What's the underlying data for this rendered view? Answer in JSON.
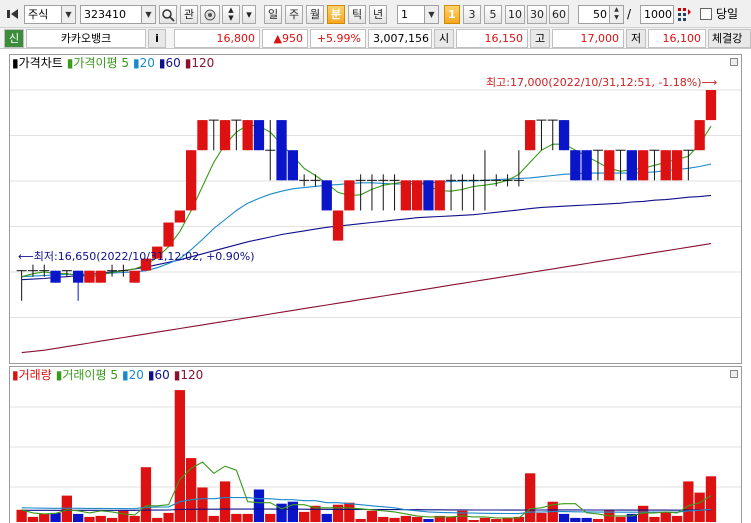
{
  "toolbar": {
    "market_select": "주식",
    "code": "323410",
    "search_icon": "search-icon",
    "btn_interest": "관",
    "period_buttons": [
      "일",
      "주",
      "월",
      "분",
      "틱",
      "년"
    ],
    "active_period": "분",
    "interval_value": "1",
    "minute_buttons": [
      "1",
      "3",
      "5",
      "10",
      "30",
      "60"
    ],
    "active_minute": "1",
    "count_value": "50",
    "slash": "/",
    "total_value": "1000",
    "same_day_label": "당일"
  },
  "quote": {
    "badge": "신",
    "name": "카카오뱅크",
    "info": "i",
    "price": "16,800",
    "change": "▲950",
    "change_pct": "+5.99%",
    "volume": "3,007,156",
    "open_label": "시",
    "open": "16,150",
    "high_label": "고",
    "high": "17,000",
    "low_label": "저",
    "low": "16,100",
    "strength_label": "체결강"
  },
  "colors": {
    "up": "#dd1111",
    "down": "#0a14c8",
    "ma5": "#3a9a1a",
    "ma20": "#1a8acb",
    "ma60": "#10108a",
    "ma120": "#8a1030"
  },
  "price_panel": {
    "title": "가격차트",
    "legend": [
      {
        "label": "가격이평 5",
        "color": "#3a9a1a"
      },
      {
        "label": "20",
        "color": "#1a8acb"
      },
      {
        "label": "60",
        "color": "#10108a"
      },
      {
        "label": "120",
        "color": "#8a1030"
      }
    ],
    "high_annotation": "최고:17,000(2022/10/31,12:51, -1.18%)⟶",
    "low_annotation": "⟵최저:16,650(2022/10/31,12:02, +0.90%)"
  },
  "volume_panel": {
    "title": "거래량",
    "legend": [
      {
        "label": "거래이평 5",
        "color": "#3a9a1a"
      },
      {
        "label": "20",
        "color": "#1a8acb"
      },
      {
        "label": "60",
        "color": "#10108a"
      },
      {
        "label": "120",
        "color": "#8a1030"
      }
    ]
  },
  "chart_data": {
    "type": "candlestick",
    "ylim": [
      16650,
      17000
    ],
    "candles": [
      {
        "o": 16700,
        "c": 16700,
        "h": 16700,
        "l": 16650,
        "d": "flat"
      },
      {
        "o": 16700,
        "c": 16700,
        "h": 16710,
        "l": 16690,
        "d": "flat"
      },
      {
        "o": 16700,
        "c": 16700,
        "h": 16710,
        "l": 16690,
        "d": "flat"
      },
      {
        "o": 16700,
        "c": 16680,
        "h": 16700,
        "l": 16680,
        "d": "down"
      },
      {
        "o": 16700,
        "c": 16700,
        "h": 16700,
        "l": 16690,
        "d": "flat"
      },
      {
        "o": 16700,
        "c": 16680,
        "h": 16700,
        "l": 16650,
        "d": "down"
      },
      {
        "o": 16680,
        "c": 16700,
        "h": 16700,
        "l": 16680,
        "d": "up"
      },
      {
        "o": 16680,
        "c": 16700,
        "h": 16700,
        "l": 16680,
        "d": "up"
      },
      {
        "o": 16700,
        "c": 16700,
        "h": 16710,
        "l": 16690,
        "d": "flat"
      },
      {
        "o": 16700,
        "c": 16700,
        "h": 16710,
        "l": 16690,
        "d": "flat"
      },
      {
        "o": 16680,
        "c": 16700,
        "h": 16700,
        "l": 16680,
        "d": "up"
      },
      {
        "o": 16700,
        "c": 16720,
        "h": 16720,
        "l": 16700,
        "d": "up"
      },
      {
        "o": 16720,
        "c": 16740,
        "h": 16740,
        "l": 16720,
        "d": "up"
      },
      {
        "o": 16740,
        "c": 16780,
        "h": 16780,
        "l": 16740,
        "d": "up"
      },
      {
        "o": 16780,
        "c": 16800,
        "h": 16800,
        "l": 16780,
        "d": "up"
      },
      {
        "o": 16800,
        "c": 16900,
        "h": 16900,
        "l": 16800,
        "d": "up"
      },
      {
        "o": 16900,
        "c": 16950,
        "h": 16950,
        "l": 16900,
        "d": "up"
      },
      {
        "o": 16950,
        "c": 16950,
        "h": 16950,
        "l": 16900,
        "d": "flat"
      },
      {
        "o": 16900,
        "c": 16950,
        "h": 16950,
        "l": 16900,
        "d": "up"
      },
      {
        "o": 16950,
        "c": 16950,
        "h": 16950,
        "l": 16900,
        "d": "flat"
      },
      {
        "o": 16900,
        "c": 16950,
        "h": 16950,
        "l": 16900,
        "d": "up"
      },
      {
        "o": 16950,
        "c": 16900,
        "h": 16950,
        "l": 16900,
        "d": "down"
      },
      {
        "o": 16900,
        "c": 16900,
        "h": 16950,
        "l": 16850,
        "d": "flat"
      },
      {
        "o": 16950,
        "c": 16850,
        "h": 16950,
        "l": 16850,
        "d": "down"
      },
      {
        "o": 16900,
        "c": 16850,
        "h": 16900,
        "l": 16850,
        "d": "down"
      },
      {
        "o": 16850,
        "c": 16850,
        "h": 16860,
        "l": 16840,
        "d": "flat"
      },
      {
        "o": 16850,
        "c": 16850,
        "h": 16860,
        "l": 16840,
        "d": "flat"
      },
      {
        "o": 16850,
        "c": 16800,
        "h": 16850,
        "l": 16800,
        "d": "down"
      },
      {
        "o": 16750,
        "c": 16800,
        "h": 16800,
        "l": 16750,
        "d": "up"
      },
      {
        "o": 16800,
        "c": 16850,
        "h": 16850,
        "l": 16800,
        "d": "up"
      },
      {
        "o": 16850,
        "c": 16850,
        "h": 16860,
        "l": 16800,
        "d": "flat"
      },
      {
        "o": 16850,
        "c": 16850,
        "h": 16860,
        "l": 16800,
        "d": "flat"
      },
      {
        "o": 16850,
        "c": 16850,
        "h": 16860,
        "l": 16800,
        "d": "flat"
      },
      {
        "o": 16850,
        "c": 16850,
        "h": 16860,
        "l": 16800,
        "d": "flat"
      },
      {
        "o": 16800,
        "c": 16850,
        "h": 16850,
        "l": 16800,
        "d": "up"
      },
      {
        "o": 16800,
        "c": 16850,
        "h": 16850,
        "l": 16800,
        "d": "up"
      },
      {
        "o": 16850,
        "c": 16800,
        "h": 16850,
        "l": 16800,
        "d": "down"
      },
      {
        "o": 16800,
        "c": 16850,
        "h": 16850,
        "l": 16800,
        "d": "up"
      },
      {
        "o": 16850,
        "c": 16850,
        "h": 16860,
        "l": 16800,
        "d": "flat"
      },
      {
        "o": 16850,
        "c": 16850,
        "h": 16860,
        "l": 16800,
        "d": "flat"
      },
      {
        "o": 16850,
        "c": 16850,
        "h": 16860,
        "l": 16800,
        "d": "flat"
      },
      {
        "o": 16850,
        "c": 16850,
        "h": 16900,
        "l": 16800,
        "d": "flat"
      },
      {
        "o": 16850,
        "c": 16850,
        "h": 16860,
        "l": 16840,
        "d": "flat"
      },
      {
        "o": 16850,
        "c": 16850,
        "h": 16860,
        "l": 16840,
        "d": "flat"
      },
      {
        "o": 16850,
        "c": 16850,
        "h": 16900,
        "l": 16840,
        "d": "flat"
      },
      {
        "o": 16900,
        "c": 16950,
        "h": 16950,
        "l": 16900,
        "d": "up"
      },
      {
        "o": 16950,
        "c": 16950,
        "h": 16950,
        "l": 16900,
        "d": "flat"
      },
      {
        "o": 16950,
        "c": 16950,
        "h": 16950,
        "l": 16900,
        "d": "flat"
      },
      {
        "o": 16950,
        "c": 16900,
        "h": 16950,
        "l": 16900,
        "d": "down"
      },
      {
        "o": 16900,
        "c": 16850,
        "h": 16900,
        "l": 16850,
        "d": "down"
      },
      {
        "o": 16900,
        "c": 16850,
        "h": 16900,
        "l": 16850,
        "d": "down"
      },
      {
        "o": 16900,
        "c": 16900,
        "h": 16900,
        "l": 16850,
        "d": "flat"
      },
      {
        "o": 16850,
        "c": 16900,
        "h": 16900,
        "l": 16850,
        "d": "up"
      },
      {
        "o": 16900,
        "c": 16900,
        "h": 16900,
        "l": 16850,
        "d": "flat"
      },
      {
        "o": 16900,
        "c": 16850,
        "h": 16900,
        "l": 16850,
        "d": "down"
      },
      {
        "o": 16850,
        "c": 16900,
        "h": 16900,
        "l": 16850,
        "d": "up"
      },
      {
        "o": 16900,
        "c": 16900,
        "h": 16900,
        "l": 16850,
        "d": "flat"
      },
      {
        "o": 16850,
        "c": 16900,
        "h": 16900,
        "l": 16850,
        "d": "up"
      },
      {
        "o": 16850,
        "c": 16900,
        "h": 16900,
        "l": 16850,
        "d": "up"
      },
      {
        "o": 16900,
        "c": 16900,
        "h": 16900,
        "l": 16850,
        "d": "flat"
      },
      {
        "o": 16900,
        "c": 16950,
        "h": 16950,
        "l": 16900,
        "d": "up"
      },
      {
        "o": 16950,
        "c": 17000,
        "h": 17000,
        "l": 16950,
        "d": "up"
      }
    ],
    "ma5": [
      16690,
      16695,
      16698,
      16695,
      16695,
      16692,
      16690,
      16693,
      16697,
      16700,
      16703,
      16710,
      16722,
      16740,
      16765,
      16800,
      16840,
      16880,
      16910,
      16930,
      16942,
      16940,
      16930,
      16910,
      16890,
      16870,
      16858,
      16845,
      16830,
      16825,
      16826,
      16835,
      16842,
      16845,
      16848,
      16848,
      16840,
      16833,
      16832,
      16835,
      16840,
      16842,
      16845,
      16850,
      16860,
      16880,
      16900,
      16910,
      16910,
      16900,
      16890,
      16880,
      16870,
      16865,
      16868,
      16870,
      16875,
      16880,
      16885,
      16890,
      16910,
      16940
    ],
    "ma20": [
      16690,
      16691,
      16692,
      16693,
      16694,
      16694,
      16694,
      16695,
      16696,
      16697,
      16698,
      16700,
      16705,
      16712,
      16720,
      16735,
      16752,
      16770,
      16785,
      16800,
      16812,
      16820,
      16827,
      16832,
      16836,
      16838,
      16840,
      16842,
      16843,
      16845,
      16846,
      16846,
      16845,
      16844,
      16844,
      16845,
      16846,
      16847,
      16848,
      16849,
      16849,
      16850,
      16851,
      16852,
      16853,
      16854,
      16856,
      16858,
      16860,
      16861,
      16862,
      16862,
      16862,
      16862,
      16862,
      16863,
      16864,
      16866,
      16868,
      16870,
      16873,
      16877
    ],
    "ma60": [
      16685,
      16686,
      16687,
      16689,
      16690,
      16692,
      16694,
      16696,
      16698,
      16700,
      16703,
      16706,
      16710,
      16714,
      16718,
      16723,
      16728,
      16733,
      16738,
      16743,
      16748,
      16752,
      16756,
      16760,
      16763,
      16766,
      16769,
      16772,
      16774,
      16776,
      16778,
      16780,
      16782,
      16784,
      16786,
      16788,
      16789,
      16790,
      16791,
      16792,
      16793,
      16795,
      16797,
      16799,
      16801,
      16803,
      16805,
      16806,
      16807,
      16808,
      16809,
      16810,
      16811,
      16812,
      16814,
      16815,
      16817,
      16818,
      16820,
      16822,
      16823,
      16825
    ],
    "ma120": [
      16564,
      16566,
      16568,
      16571,
      16574,
      16577,
      16580,
      16583,
      16586,
      16589,
      16592,
      16595,
      16598,
      16601,
      16604,
      16607,
      16610,
      16613,
      16616,
      16619,
      16622,
      16625,
      16628,
      16631,
      16634,
      16637,
      16640,
      16643,
      16646,
      16649,
      16652,
      16655,
      16658,
      16661,
      16664,
      16667,
      16670,
      16673,
      16676,
      16679,
      16682,
      16685,
      16688,
      16691,
      16694,
      16697,
      16700,
      16703,
      16706,
      16709,
      16712,
      16715,
      16718,
      16721,
      16724,
      16727,
      16730,
      16733,
      16736,
      16739,
      16742,
      16745
    ],
    "volume": [
      12000,
      5000,
      8000,
      9000,
      26000,
      8000,
      5000,
      6000,
      4000,
      11000,
      6000,
      54000,
      4000,
      9000,
      130000,
      63000,
      34000,
      6000,
      40000,
      8000,
      8000,
      32000,
      8000,
      18000,
      20000,
      10000,
      16000,
      8000,
      17000,
      19000,
      3000,
      11000,
      5000,
      4000,
      6000,
      5000,
      3000,
      6000,
      5000,
      11000,
      2000,
      4000,
      3000,
      4000,
      5000,
      48000,
      9000,
      20000,
      8000,
      4000,
      4000,
      3000,
      12000,
      5000,
      8000,
      16000,
      5000,
      10000,
      6000,
      40000,
      29000,
      45000
    ],
    "vol_ma5": [
      12000,
      9000,
      8000,
      8500,
      12000,
      11000,
      9000,
      11000,
      10000,
      8000,
      7000,
      16000,
      16000,
      17000,
      42000,
      53000,
      59000,
      48000,
      55000,
      51000,
      20000,
      19000,
      19000,
      13000,
      17000,
      17000,
      14000,
      14000,
      14000,
      14000,
      13000,
      12000,
      11000,
      10000,
      8000,
      6000,
      5000,
      5000,
      5000,
      6000,
      5000,
      5000,
      4000,
      4000,
      4000,
      13000,
      14000,
      17000,
      18000,
      18000,
      9000,
      8000,
      6000,
      6000,
      6000,
      9000,
      9000,
      10000,
      9000,
      16000,
      19000,
      26000
    ],
    "vol_ma20": [
      14000,
      13800,
      13600,
      13500,
      13600,
      13500,
      13400,
      13400,
      13300,
      13200,
      13100,
      14500,
      14700,
      14900,
      20000,
      22000,
      23000,
      23000,
      24000,
      24000,
      24000,
      23000,
      23000,
      22000,
      22000,
      21000,
      21000,
      19000,
      19000,
      18000,
      17000,
      16000,
      15000,
      14000,
      12000,
      11000,
      10000,
      9500,
      9200,
      9000,
      8800,
      8600,
      8500,
      8400,
      8300,
      9800,
      9900,
      10200,
      10200,
      10100,
      10000,
      9800,
      9800,
      9700,
      9700,
      9800,
      9800,
      9800,
      9700,
      11000,
      11500,
      12500
    ],
    "vol_ma60": [
      11500,
      11500,
      11500,
      11500,
      11500,
      11500,
      11500,
      11500,
      11500,
      11500,
      11500,
      11700,
      11700,
      11800,
      12300,
      12500,
      12600,
      12600,
      12700,
      12700,
      12700,
      12700,
      12700,
      12600,
      12600,
      12600,
      12500,
      12500,
      12400,
      12400,
      12300,
      12300,
      12200,
      12200,
      12100,
      12100,
      12000,
      12000,
      11900,
      11900,
      11800,
      11800,
      11800,
      11700,
      11700,
      11800,
      11800,
      11900,
      11900,
      11900,
      11800,
      11800,
      11800,
      11700,
      11700,
      11700,
      11700,
      11700,
      11600,
      11700,
      11800,
      11900
    ],
    "vol_ylim": [
      0,
      135000
    ]
  }
}
